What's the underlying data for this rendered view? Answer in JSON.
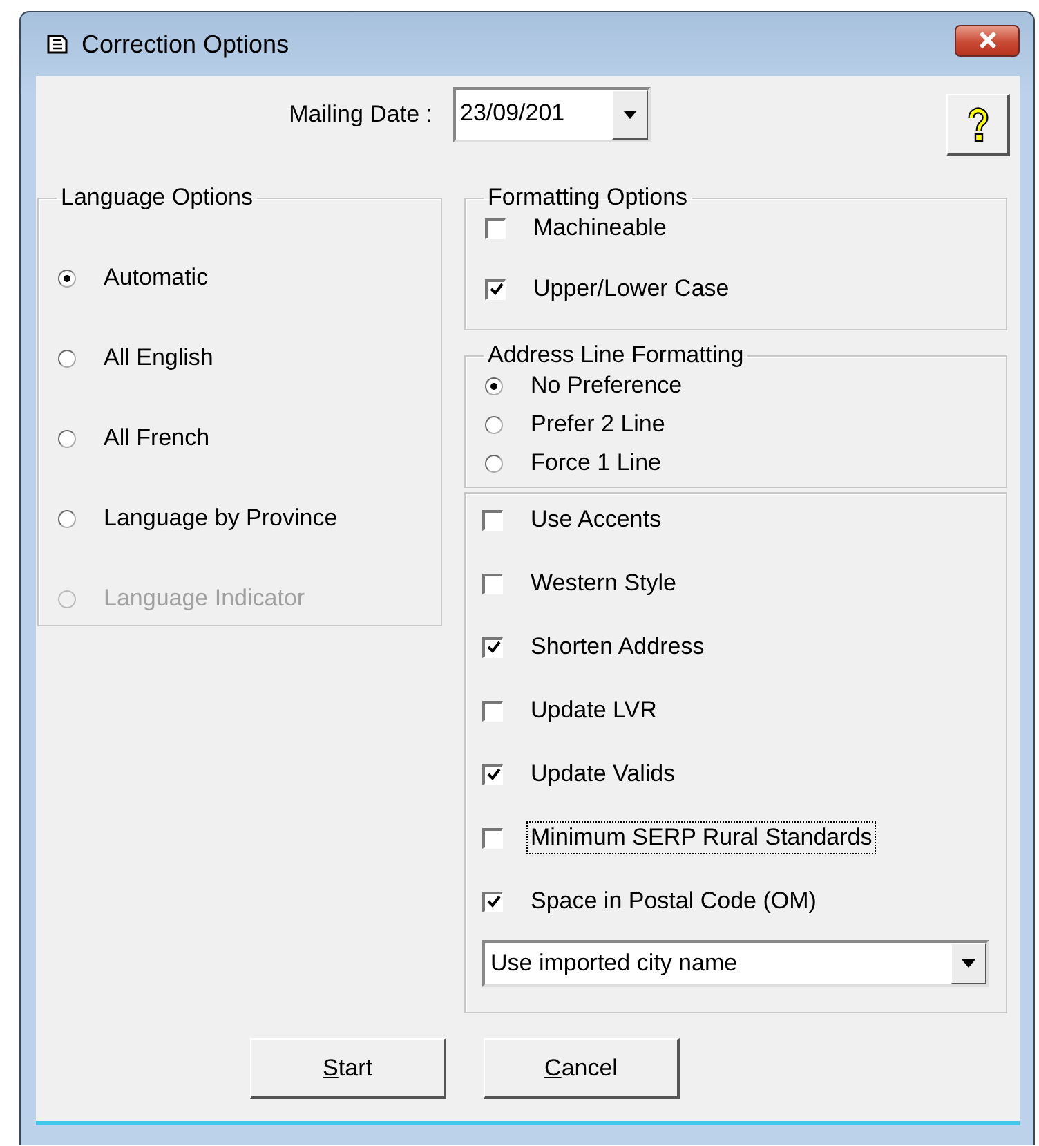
{
  "window": {
    "title": "Correction Options"
  },
  "mailing_date": {
    "label": "Mailing Date :",
    "value": "23/09/201"
  },
  "language_options": {
    "title": "Language Options",
    "options": [
      {
        "label": "Automatic",
        "selected": true,
        "disabled": false
      },
      {
        "label": "All English",
        "selected": false,
        "disabled": false
      },
      {
        "label": "All French",
        "selected": false,
        "disabled": false
      },
      {
        "label": "Language by Province",
        "selected": false,
        "disabled": false
      },
      {
        "label": "Language Indicator",
        "selected": false,
        "disabled": true
      }
    ]
  },
  "formatting_options": {
    "title": "Formatting Options",
    "options": [
      {
        "label": "Machineable",
        "checked": false
      },
      {
        "label": "Upper/Lower Case",
        "checked": true
      }
    ]
  },
  "address_line_formatting": {
    "title": "Address Line Formatting",
    "options": [
      {
        "label": "No Preference",
        "selected": true
      },
      {
        "label": "Prefer 2 Line",
        "selected": false
      },
      {
        "label": "Force 1 Line",
        "selected": false
      }
    ]
  },
  "other_options": {
    "options": [
      {
        "label": "Use Accents",
        "checked": false,
        "focused": false
      },
      {
        "label": "Western Style",
        "checked": false,
        "focused": false
      },
      {
        "label": "Shorten Address",
        "checked": true,
        "focused": false
      },
      {
        "label": "Update LVR",
        "checked": false,
        "focused": false
      },
      {
        "label": "Update Valids",
        "checked": true,
        "focused": false
      },
      {
        "label": "Minimum SERP Rural Standards",
        "checked": false,
        "focused": true
      },
      {
        "label": "Space in Postal Code (OM)",
        "checked": true,
        "focused": false
      }
    ],
    "city_name": {
      "value": "Use imported city name"
    }
  },
  "buttons": [
    {
      "label": "Start",
      "access_key_underlined": true
    },
    {
      "label": "Cancel",
      "access_key_underlined": true
    }
  ]
}
